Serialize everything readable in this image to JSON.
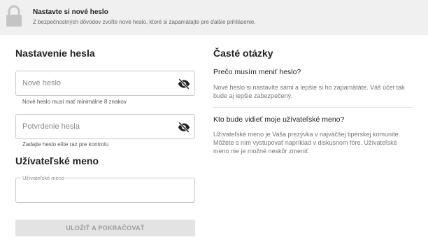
{
  "banner": {
    "icon": "lock-icon",
    "title": "Nastavte si nové heslo",
    "subtitle": "Z bezpečnostných dôvodov zvoľte nové heslo, ktoré si zapamätajte pre ďalšie prihlásenie."
  },
  "password_section": {
    "title": "Nastavenie hesla",
    "new_password": {
      "placeholder": "Nové heslo",
      "value": "",
      "hint": "Nové heslo musí mať minimálne 8 znakov",
      "icon": "eye-off-icon"
    },
    "confirm_password": {
      "placeholder": "Potvrdenie hesla",
      "value": "",
      "hint": "Zadajte heslo ešte raz pre kontrolu",
      "icon": "eye-off-icon"
    }
  },
  "username_section": {
    "title": "Užívateľské meno",
    "field": {
      "label": "Užívateľské meno",
      "value": ""
    }
  },
  "submit": {
    "label": "ULOŽIŤ A POKRAČOVAŤ",
    "disabled": true
  },
  "faq": {
    "title": "Časté otázky",
    "items": [
      {
        "question": "Prečo musím meniť heslo?",
        "answer_lines": [
          "Nové heslo si nastavíte sami a lepšie si ho zapamätáte. Váš účet tak",
          "bude aj lepšie zabezpečený."
        ]
      },
      {
        "question": "Kto bude vidieť moje užívateľské meno?",
        "answer_lines": [
          "Užívateľské meno je Vaša prezývka v najväčšej tipérskej komunite.",
          "Môžete s ním vystupovať napríklad v diskusnom fóre. Užívateľské",
          "meno nie je možné neskôr zmeniť."
        ]
      }
    ]
  }
}
